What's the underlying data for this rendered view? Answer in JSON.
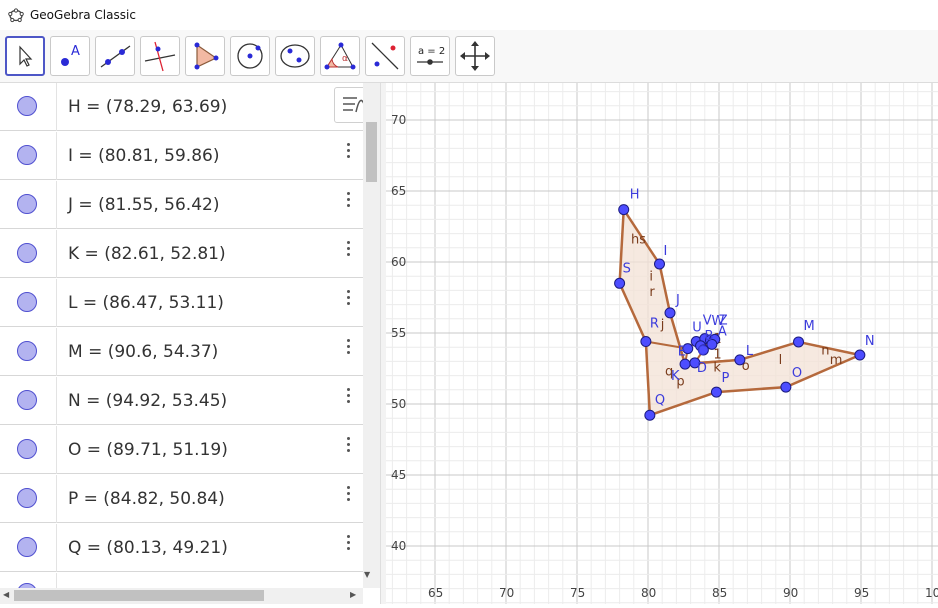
{
  "window": {
    "title": "GeoGebra Classic"
  },
  "toolbar": {
    "tools": [
      "move-tool",
      "point-tool",
      "line-tool",
      "perpendicular-line-tool",
      "polygon-tool",
      "circle-center-point-tool",
      "ellipse-tool",
      "angle-tool",
      "reflect-tool",
      "slider-tool",
      "move-graphics-view-tool"
    ],
    "active": "move-tool",
    "slider_label": "a = 2"
  },
  "algebra": {
    "rows": [
      {
        "name": "H",
        "text": "H = (78.29, 63.69)"
      },
      {
        "name": "I",
        "text": "I = (80.81, 59.86)"
      },
      {
        "name": "J",
        "text": "J = (81.55, 56.42)"
      },
      {
        "name": "K",
        "text": "K = (82.61, 52.81)"
      },
      {
        "name": "L",
        "text": "L = (86.47, 53.11)"
      },
      {
        "name": "M",
        "text": "M = (90.6, 54.37)"
      },
      {
        "name": "N",
        "text": "N = (94.92, 53.45)"
      },
      {
        "name": "O",
        "text": "O = (89.71, 51.19)"
      },
      {
        "name": "P",
        "text": "P = (84.82, 50.84)"
      },
      {
        "name": "Q",
        "text": "Q = (80.13, 49.21)"
      }
    ]
  },
  "graphics": {
    "x_ticks": [
      "65",
      "70",
      "75",
      "80",
      "85",
      "90",
      "95",
      "10"
    ],
    "y_ticks": [
      "70",
      "65",
      "60",
      "55",
      "50",
      "45",
      "40"
    ],
    "points": [
      {
        "label": "H",
        "x": 78.29,
        "y": 63.69
      },
      {
        "label": "I",
        "x": 80.81,
        "y": 59.86
      },
      {
        "label": "J",
        "x": 81.55,
        "y": 56.42
      },
      {
        "label": "K",
        "x": 82.61,
        "y": 52.81
      },
      {
        "label": "L",
        "x": 86.47,
        "y": 53.11
      },
      {
        "label": "M",
        "x": 90.6,
        "y": 54.37
      },
      {
        "label": "N",
        "x": 94.92,
        "y": 53.45
      },
      {
        "label": "O",
        "x": 89.71,
        "y": 51.19
      },
      {
        "label": "P",
        "x": 84.82,
        "y": 50.84
      },
      {
        "label": "Q",
        "x": 80.13,
        "y": 49.21
      },
      {
        "label": "R",
        "x": 79.85,
        "y": 54.4
      },
      {
        "label": "S",
        "x": 78.0,
        "y": 58.5
      },
      {
        "label": "U",
        "x": 83.4,
        "y": 54.4
      },
      {
        "label": "V",
        "x": 84.0,
        "y": 54.6
      },
      {
        "label": "W",
        "x": 84.4,
        "y": 54.5
      },
      {
        "label": "Z",
        "x": 84.7,
        "y": 54.55
      },
      {
        "label": "A",
        "x": 84.5,
        "y": 54.2
      },
      {
        "label": "B",
        "x": 83.7,
        "y": 54.1
      },
      {
        "label": "C",
        "x": 83.9,
        "y": 53.8
      },
      {
        "label": "D",
        "x": 83.3,
        "y": 52.9
      },
      {
        "label": "E",
        "x": 82.8,
        "y": 53.9
      }
    ],
    "polygon_outline": [
      "H",
      "I",
      "J",
      "K",
      "L",
      "M",
      "N",
      "O",
      "P",
      "Q",
      "R",
      "S"
    ],
    "segment_labels": [
      "hs",
      "i",
      "r",
      "j",
      "q",
      "p",
      "k",
      "o",
      "l",
      "n",
      "m",
      "1",
      "1"
    ],
    "colors": {
      "point": "#4d4dff",
      "segment": "#b5693c",
      "fill": "#f3e1d6",
      "label": "#3c3cdc"
    }
  }
}
